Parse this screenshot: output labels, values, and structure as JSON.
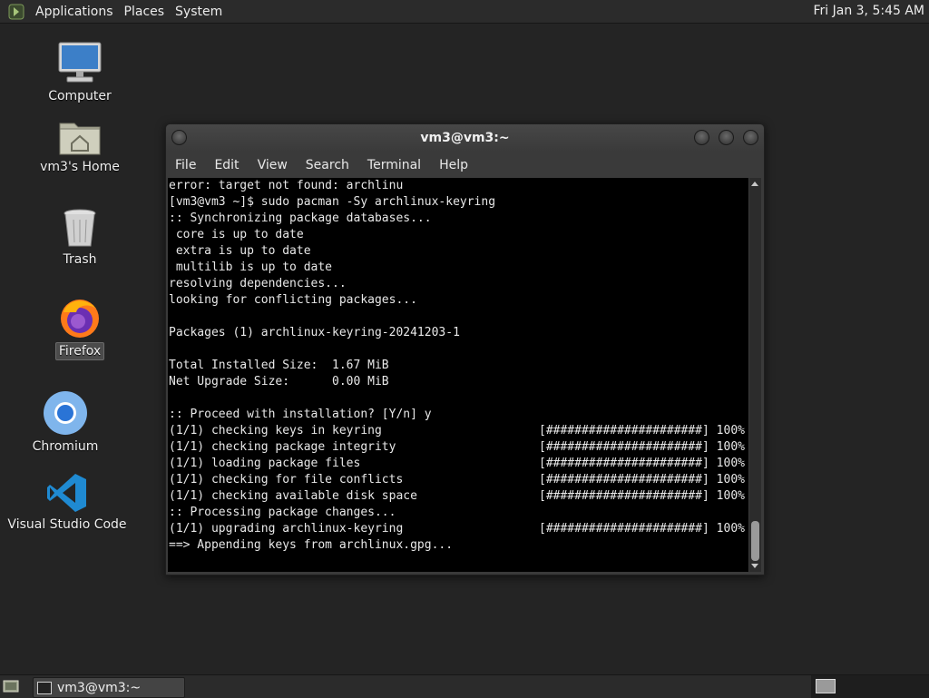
{
  "top_panel": {
    "menus": [
      "Applications",
      "Places",
      "System"
    ],
    "clock": "Fri Jan  3,  5:45 AM"
  },
  "desktop_icons": [
    {
      "label": "Computer",
      "icon": "computer-icon"
    },
    {
      "label": "vm3's Home",
      "icon": "home-folder-icon"
    },
    {
      "label": "Trash",
      "icon": "trash-icon"
    },
    {
      "label": "Firefox",
      "icon": "firefox-icon"
    },
    {
      "label": "Chromium",
      "icon": "chromium-icon"
    },
    {
      "label": "Visual Studio Code",
      "icon": "vscode-icon"
    }
  ],
  "terminal": {
    "title": "vm3@vm3:~",
    "menu": [
      "File",
      "Edit",
      "View",
      "Search",
      "Terminal",
      "Help"
    ],
    "lines": [
      {
        "text": "error: target not found: archlinu",
        "progress": ""
      },
      {
        "text": "[vm3@vm3 ~]$ sudo pacman -Sy archlinux-keyring",
        "progress": ""
      },
      {
        "text": ":: Synchronizing package databases...",
        "progress": ""
      },
      {
        "text": " core is up to date",
        "progress": ""
      },
      {
        "text": " extra is up to date",
        "progress": ""
      },
      {
        "text": " multilib is up to date",
        "progress": ""
      },
      {
        "text": "resolving dependencies...",
        "progress": ""
      },
      {
        "text": "looking for conflicting packages...",
        "progress": ""
      },
      {
        "text": "",
        "progress": ""
      },
      {
        "text": "Packages (1) archlinux-keyring-20241203-1",
        "progress": ""
      },
      {
        "text": "",
        "progress": ""
      },
      {
        "text": "Total Installed Size:  1.67 MiB",
        "progress": ""
      },
      {
        "text": "Net Upgrade Size:      0.00 MiB",
        "progress": ""
      },
      {
        "text": "",
        "progress": ""
      },
      {
        "text": ":: Proceed with installation? [Y/n] y",
        "progress": ""
      },
      {
        "text": "(1/1) checking keys in keyring",
        "progress": "[######################] 100%"
      },
      {
        "text": "(1/1) checking package integrity",
        "progress": "[######################] 100%"
      },
      {
        "text": "(1/1) loading package files",
        "progress": "[######################] 100%"
      },
      {
        "text": "(1/1) checking for file conflicts",
        "progress": "[######################] 100%"
      },
      {
        "text": "(1/1) checking available disk space",
        "progress": "[######################] 100%"
      },
      {
        "text": ":: Processing package changes...",
        "progress": ""
      },
      {
        "text": "(1/1) upgrading archlinux-keyring",
        "progress": "[######################] 100%"
      },
      {
        "text": "==> Appending keys from archlinux.gpg...",
        "progress": ""
      }
    ]
  },
  "taskbar": {
    "task_label": "vm3@vm3:~"
  }
}
